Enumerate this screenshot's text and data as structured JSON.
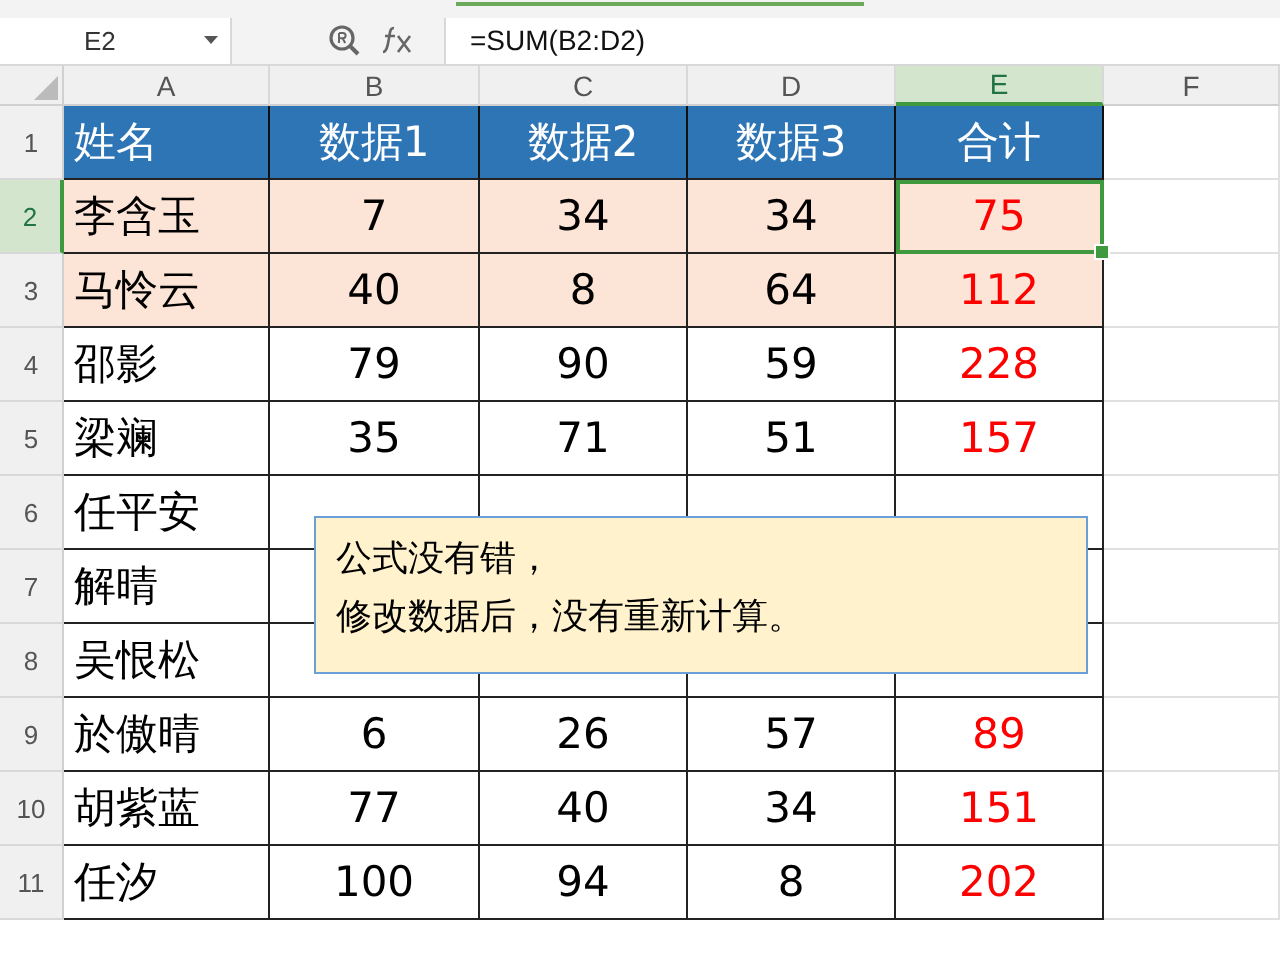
{
  "name_box": "E2",
  "formula": "=SUM(B2:D2)",
  "columns": [
    {
      "label": "A",
      "kind": "name",
      "selected": false
    },
    {
      "label": "B",
      "kind": "number",
      "selected": false
    },
    {
      "label": "C",
      "kind": "number",
      "selected": false
    },
    {
      "label": "D",
      "kind": "number",
      "selected": false
    },
    {
      "label": "E",
      "kind": "total",
      "selected": true
    },
    {
      "label": "F",
      "kind": "empty",
      "selected": false
    }
  ],
  "rows": [
    {
      "number": "1",
      "kind": "header",
      "selected": false,
      "cells": [
        "姓名",
        "数据1",
        "数据2",
        "数据3",
        "合计"
      ]
    },
    {
      "number": "2",
      "kind": "highlight",
      "selected": true,
      "cells": [
        "李含玉",
        "7",
        "34",
        "34",
        "75"
      ]
    },
    {
      "number": "3",
      "kind": "highlight",
      "selected": false,
      "cells": [
        "马怜云",
        "40",
        "8",
        "64",
        "112"
      ]
    },
    {
      "number": "4",
      "kind": "plain",
      "selected": false,
      "cells": [
        "邵影",
        "79",
        "90",
        "59",
        "228"
      ]
    },
    {
      "number": "5",
      "kind": "plain",
      "selected": false,
      "cells": [
        "梁斓",
        "35",
        "71",
        "51",
        "157"
      ]
    },
    {
      "number": "6",
      "kind": "plain",
      "selected": false,
      "cells": [
        "任平安"
      ]
    },
    {
      "number": "7",
      "kind": "plain",
      "selected": false,
      "cells": [
        "解晴"
      ]
    },
    {
      "number": "8",
      "kind": "plain",
      "selected": false,
      "cells": [
        "吴恨松"
      ]
    },
    {
      "number": "9",
      "kind": "plain",
      "selected": false,
      "cells": [
        "於傲晴",
        "6",
        "26",
        "57",
        "89"
      ]
    },
    {
      "number": "10",
      "kind": "plain",
      "selected": false,
      "cells": [
        "胡紫蓝",
        "77",
        "40",
        "34",
        "151"
      ]
    },
    {
      "number": "11",
      "kind": "plain",
      "selected": false,
      "cells": [
        "任汐",
        "100",
        "94",
        "8",
        "202"
      ]
    }
  ],
  "callout": {
    "lines": [
      "公式没有错，",
      "修改数据后，没有重新计算。"
    ]
  }
}
